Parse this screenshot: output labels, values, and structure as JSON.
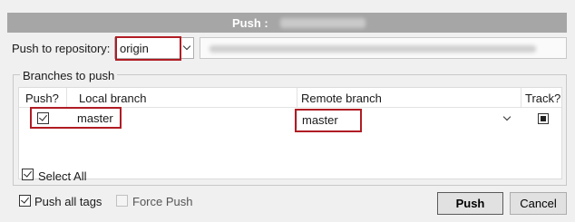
{
  "window": {
    "title": "Push :"
  },
  "repository": {
    "label": "Push to repository:",
    "selected": "origin"
  },
  "branches_group": {
    "legend": "Branches to push",
    "columns": {
      "push": "Push?",
      "local": "Local branch",
      "remote": "Remote branch",
      "track": "Track?"
    },
    "rows": [
      {
        "push_checked": true,
        "local": "master",
        "remote": "master",
        "track": "indeterminate"
      }
    ],
    "select_all_label": "Select All",
    "select_all_checked": true
  },
  "options": {
    "push_all_tags_label": "Push all tags",
    "push_all_tags_checked": true,
    "force_push_label": "Force Push",
    "force_push_checked": false
  },
  "buttons": {
    "push": "Push",
    "cancel": "Cancel"
  },
  "colors": {
    "titlebar": "#a6a6a6",
    "highlight": "#b01c24",
    "dialog_bg": "#f0f0f0"
  }
}
